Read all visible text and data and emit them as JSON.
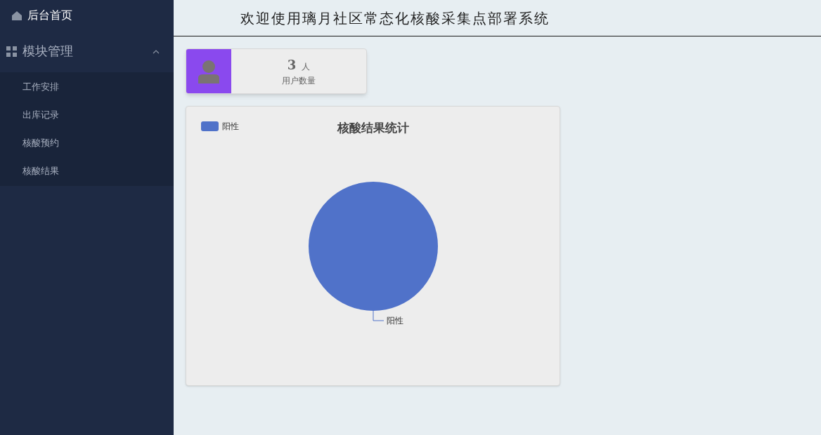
{
  "sidebar": {
    "home": {
      "label": "后台首页"
    },
    "groups": [
      {
        "label": "模块管理",
        "expanded": true,
        "items": [
          {
            "label": "工作安排"
          },
          {
            "label": "出库记录"
          },
          {
            "label": "核酸预约"
          },
          {
            "label": "核酸结果"
          }
        ]
      }
    ]
  },
  "header": {
    "title": "欢迎使用璃月社区常态化核酸采集点部署系统"
  },
  "stat_card": {
    "value": "3",
    "unit": "人",
    "label": "用户数量"
  },
  "chart_panel": {
    "title": "核酸结果统计",
    "legend": [
      {
        "label": "阳性",
        "color": "#5072c9"
      }
    ],
    "pie_labels": [
      {
        "label": "阳性",
        "color": "#5072c9"
      }
    ]
  }
}
